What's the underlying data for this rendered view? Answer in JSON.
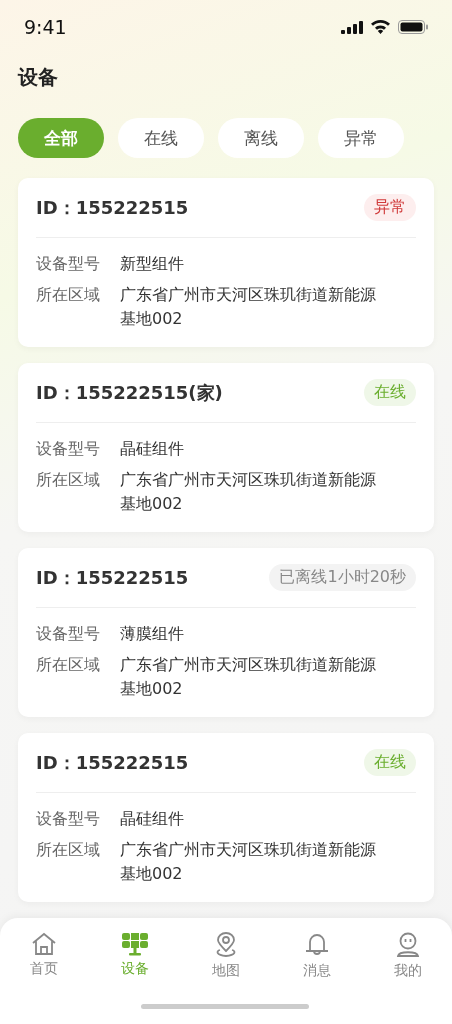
{
  "status_bar": {
    "time": "9:41"
  },
  "title": "设备",
  "filters": [
    {
      "label": "全部",
      "selected": true
    },
    {
      "label": "在线",
      "selected": false
    },
    {
      "label": "离线",
      "selected": false
    },
    {
      "label": "异常",
      "selected": false
    }
  ],
  "devices": [
    {
      "id": "ID：155222515",
      "kind": "abnormal",
      "badge": "异常",
      "fields": [
        {
          "label": "设备型号",
          "value": "新型组件"
        },
        {
          "label": "所在区域",
          "value": "广东省广州市天河区珠玑街道新能源基地002"
        }
      ]
    },
    {
      "id": "ID：155222515(家)",
      "kind": "online",
      "badge": "在线",
      "fields": [
        {
          "label": "设备型号",
          "value": "晶硅组件"
        },
        {
          "label": "所在区域",
          "value": "广东省广州市天河区珠玑街道新能源基地002"
        }
      ]
    },
    {
      "id": "ID：155222515",
      "kind": "offline",
      "badge": "已离线1小时20秒",
      "fields": [
        {
          "label": "设备型号",
          "value": "薄膜组件"
        },
        {
          "label": "所在区域",
          "value": "广东省广州市天河区珠玑街道新能源基地002"
        }
      ]
    },
    {
      "id": "ID：155222515",
      "kind": "online",
      "badge": "在线",
      "fields": [
        {
          "label": "设备型号",
          "value": "晶硅组件"
        },
        {
          "label": "所在区域",
          "value": "广东省广州市天河区珠玑街道新能源基地002"
        }
      ]
    }
  ],
  "tab_bar": [
    {
      "label": "首页",
      "kind": "home",
      "selected": false
    },
    {
      "label": "设备",
      "kind": "panel",
      "selected": true
    },
    {
      "label": "地图",
      "kind": "pin",
      "selected": false
    },
    {
      "label": "消息",
      "kind": "bell",
      "selected": false
    },
    {
      "label": "我的",
      "kind": "user",
      "selected": false
    }
  ]
}
